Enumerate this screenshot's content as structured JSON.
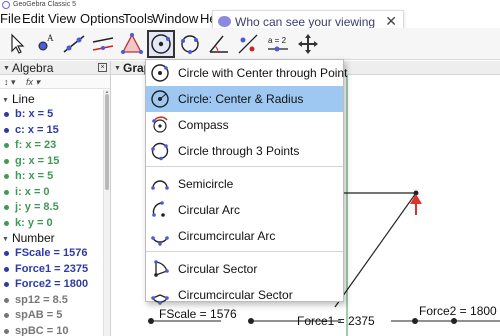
{
  "window": {
    "title": "GeoGebra Classic 5"
  },
  "menubar": [
    "File",
    "Edit",
    "View",
    "Options",
    "Tools",
    "Window",
    "He"
  ],
  "activity_popup": {
    "question": "Who can see your viewing activity?",
    "close": "✕"
  },
  "toolbar": {
    "tools": [
      "move",
      "point",
      "line",
      "perpendicular-line",
      "polygon",
      "circle-center-point",
      "circle-three-points",
      "angle",
      "reflect",
      "slider",
      "move-graphics-view"
    ],
    "active_tool": "circle-center-point",
    "slider_text": "a = 2"
  },
  "algebra": {
    "title": "Algebra",
    "categories": {
      "line": "Line",
      "number": "Number"
    },
    "lines": [
      {
        "label": "b: x = 5",
        "color": "#2e3aa8"
      },
      {
        "label": "c: x = 15",
        "color": "#2e3aa8"
      },
      {
        "label": "f: x = 23",
        "color": "#3f9a55"
      },
      {
        "label": "g: x = 15",
        "color": "#3f9a55"
      },
      {
        "label": "h: x = 5",
        "color": "#3f9a55"
      },
      {
        "label": "i: x = 0",
        "color": "#3f9a55"
      },
      {
        "label": "j: y = 8.5",
        "color": "#3f9a55"
      },
      {
        "label": "k: y = 0",
        "color": "#3f9a55"
      }
    ],
    "numbers": [
      {
        "label": "FScale = 1576",
        "color": "#2e3aa8"
      },
      {
        "label": "Force1 = 2375",
        "color": "#2e3aa8"
      },
      {
        "label": "Force2 = 1800",
        "color": "#2e3aa8"
      },
      {
        "label": "sp12 = 8.5",
        "color": "#777777"
      },
      {
        "label": "spAB = 5",
        "color": "#777777"
      },
      {
        "label": "spBC = 10",
        "color": "#777777"
      }
    ]
  },
  "graphics": {
    "title": "Grap",
    "sliders": {
      "fscale": "FScale = 1576",
      "force1": "Force1 = 2375",
      "force2": "Force2 = 1800"
    }
  },
  "menu": {
    "items": [
      {
        "label": "Circle with Center through Point",
        "icon": "circle-center-point-icon",
        "selected": false
      },
      {
        "label": "Circle: Center & Radius",
        "icon": "circle-center-radius-icon",
        "selected": true
      },
      {
        "label": "Compass",
        "icon": "compass-icon",
        "selected": false
      },
      {
        "label": "Circle through 3 Points",
        "icon": "circle-three-points-icon",
        "selected": false
      },
      {
        "label": "Semicircle",
        "icon": "semicircle-icon",
        "selected": false
      },
      {
        "label": "Circular Arc",
        "icon": "circular-arc-icon",
        "selected": false
      },
      {
        "label": "Circumcircular Arc",
        "icon": "circumcircular-arc-icon",
        "selected": false
      },
      {
        "label": "Circular Sector",
        "icon": "circular-sector-icon",
        "selected": false
      },
      {
        "label": "Circumcircular Sector",
        "icon": "circumcircular-sector-icon",
        "selected": false
      }
    ]
  },
  "colors": {
    "selection": "#9ec8f2",
    "pointer_arrow": "#e0322d",
    "object_blue": "#2e3aa8",
    "object_green": "#3f9a55"
  }
}
